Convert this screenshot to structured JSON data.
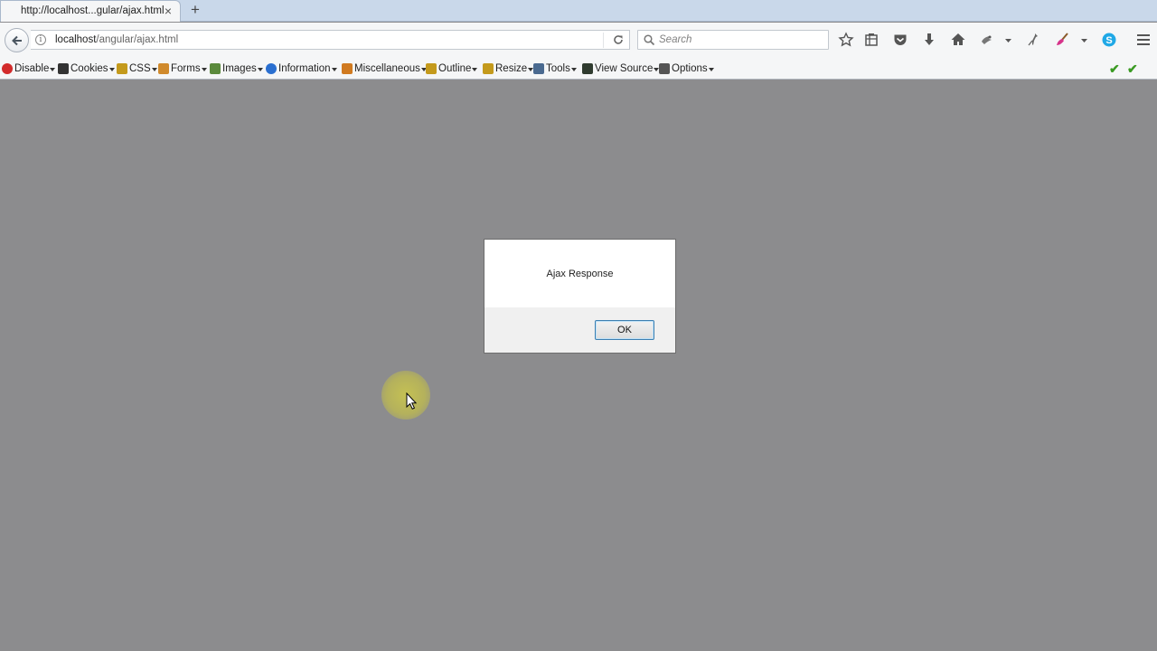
{
  "tab": {
    "title": "http://localhost...gular/ajax.html",
    "close_glyph": "×",
    "new_tab_glyph": "+"
  },
  "navbar": {
    "url_host": "localhost",
    "url_path": "/angular/ajax.html",
    "search_placeholder": "Search",
    "icons": [
      "back-arrow-icon",
      "info-icon",
      "reload-icon",
      "search-icon",
      "bookmark-star-icon",
      "reading-list-icon",
      "pocket-icon",
      "download-icon",
      "home-icon",
      "extension-icon",
      "dropdown-icon",
      "pin-icon",
      "broom-icon",
      "dropdown-icon",
      "skype-icon",
      "hamburger-menu-icon"
    ]
  },
  "devbar": {
    "items": [
      {
        "label": "Disable",
        "icon": "disable-icon",
        "color": "#d22b2b"
      },
      {
        "label": "Cookies",
        "icon": "cookies-icon",
        "color": "#333333"
      },
      {
        "label": "CSS",
        "icon": "css-icon",
        "color": "#c49a1c"
      },
      {
        "label": "Forms",
        "icon": "forms-icon",
        "color": "#d08a2c"
      },
      {
        "label": "Images",
        "icon": "images-icon",
        "color": "#5b8a3c"
      },
      {
        "label": "Information",
        "icon": "information-icon",
        "color": "#2a6fd0"
      },
      {
        "label": "Miscellaneous",
        "icon": "miscellaneous-icon",
        "color": "#d07a20"
      },
      {
        "label": "Outline",
        "icon": "outline-icon",
        "color": "#c49a1c"
      },
      {
        "label": "Resize",
        "icon": "resize-icon",
        "color": "#c49a1c"
      },
      {
        "label": "Tools",
        "icon": "tools-icon",
        "color": "#4a6a90"
      },
      {
        "label": "View Source",
        "icon": "view-source-icon",
        "color": "#2f3b2f"
      },
      {
        "label": "Options",
        "icon": "options-icon",
        "color": "#555555"
      }
    ]
  },
  "dialog": {
    "message": "Ajax Response",
    "ok_label": "OK"
  },
  "colors": {
    "page_overlay": "#8c8c8e",
    "toolbar_bg": "#f5f6f7",
    "tabstrip_bg": "#c9d8ea",
    "ok_border": "#3c7fb1",
    "check_green": "#3a9a22"
  }
}
